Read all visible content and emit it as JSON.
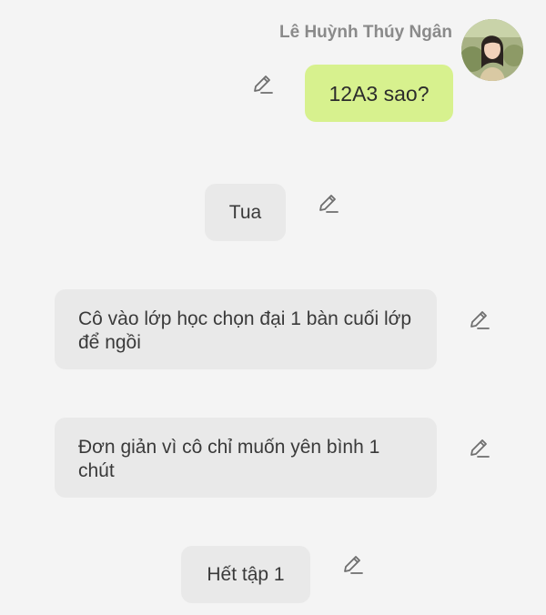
{
  "sender": {
    "name": "Lê Huỳnh Thúy Ngân"
  },
  "messages": [
    {
      "id": "m1",
      "side": "me",
      "text": "12A3 sao?"
    },
    {
      "id": "m2",
      "side": "other",
      "text": "Tua"
    },
    {
      "id": "m3",
      "side": "other",
      "text": "Cô vào lớp học chọn đại 1 bàn cuối lớp để ngồi"
    },
    {
      "id": "m4",
      "side": "other",
      "text": "Đơn giản vì cô chỉ muốn yên bình 1 chút"
    },
    {
      "id": "m5",
      "side": "other",
      "text": "Hết tập 1"
    }
  ],
  "icons": {
    "edit": "pencil-edit-icon",
    "avatar": "profile-photo"
  },
  "colors": {
    "background": "#f4f4f4",
    "my_bubble": "#d7f18e",
    "other_bubble": "#e9e9e9",
    "name_text": "#8a8a8a",
    "icon_stroke": "#6e6e6e"
  }
}
